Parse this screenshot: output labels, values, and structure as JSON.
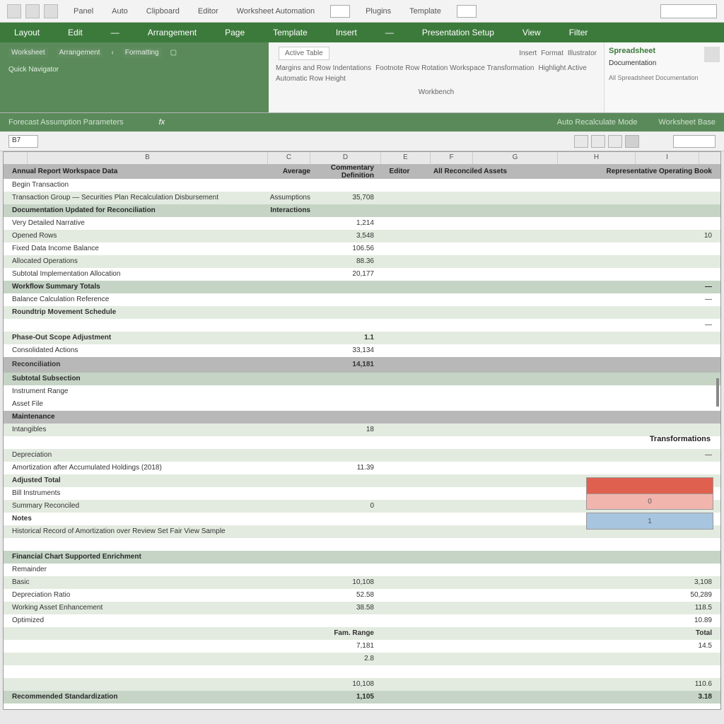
{
  "topStrip": {
    "menus": [
      "Panel",
      "Auto",
      "Clipboard",
      "Editor",
      "Worksheet Automation",
      "Plugins",
      "Template"
    ]
  },
  "ribbonTabs": [
    "Layout",
    "Edit",
    "—",
    "Arrangement",
    "Page",
    "Template",
    "Insert",
    "—",
    "Presentation Setup",
    "View",
    "Filter"
  ],
  "ribbonLeft": {
    "row1": [
      "Worksheet",
      "Arrangement",
      "Formatting"
    ],
    "row2": "Quick Navigator"
  },
  "ribbonCenter": {
    "input1": "Active Table",
    "labels1": [
      "Insert",
      "Format",
      "Illustrator"
    ],
    "line2a": "Margins and Row Indentations",
    "line2b": "Footnote Row Rotation Workspace Transformation",
    "line2c": "Highlight Active",
    "line3": "Automatic Row Height",
    "bottom": "Workbench"
  },
  "ribbonRight": {
    "title": "Spreadsheet",
    "item": "Documentation",
    "sub": "All Spreadsheet Documentation"
  },
  "greenBar": {
    "left": "Forecast Assumption Parameters",
    "fx": "fx",
    "mid1": "Auto Recalculate Mode",
    "mid2": "Worksheet Base"
  },
  "viewBar": {
    "cell": "B7"
  },
  "colHeaders": [
    "",
    "B",
    "C",
    "D",
    "E",
    "F",
    "G",
    "H",
    "I"
  ],
  "headerRow": {
    "label": "Annual Report Workspace Data",
    "c1": "Average",
    "c2": "Commentary Definition",
    "c3": "Editor",
    "c4": "All Reconciled Assets",
    "c5": "Representative Operating Book"
  },
  "rows": [
    {
      "cls": "",
      "label": "Begin Transaction",
      "v1": "",
      "v2": ""
    },
    {
      "cls": "alt",
      "label": "Transaction Group — Securities Plan Recalculation Disbursement",
      "v1": "Assumptions",
      "v2": "35,708"
    },
    {
      "cls": "subhead",
      "label": "Documentation Updated for Reconciliation",
      "v1": "Interactions",
      "v2": ""
    },
    {
      "cls": "",
      "label": "Very Detailed Narrative",
      "v1": "",
      "v2": "1,214",
      "far": ""
    },
    {
      "cls": "alt",
      "label": "Opened Rows",
      "v1": "",
      "v2": "3,548",
      "far": "10"
    },
    {
      "cls": "",
      "label": "Fixed Data Income Balance",
      "v1": "",
      "v2": "106.56",
      "far": ""
    },
    {
      "cls": "alt",
      "label": "Allocated Operations",
      "v1": "",
      "v2": "88.36",
      "far": ""
    },
    {
      "cls": "",
      "label": "Subtotal Implementation Allocation",
      "v1": "",
      "v2": "20,177",
      "far": ""
    },
    {
      "cls": "subhead",
      "label": "Workflow Summary Totals",
      "v1": "",
      "v2": "",
      "far": "—"
    },
    {
      "cls": "",
      "label": "Balance Calculation Reference",
      "v1": "",
      "v2": "",
      "far": "—"
    },
    {
      "cls": "alt bold",
      "label": "Roundtrip Movement Schedule",
      "v1": "",
      "v2": "",
      "far": ""
    },
    {
      "cls": "",
      "label": "",
      "v1": "",
      "v2": "",
      "far": "—"
    },
    {
      "cls": "alt bold",
      "label": "Phase-Out Scope Adjustment",
      "v1": "",
      "v2": "1.1",
      "far": ""
    },
    {
      "cls": "",
      "label": "Consolidated Actions",
      "v1": "",
      "v2": "33,134",
      "far": ""
    },
    {
      "cls": "greysec",
      "label": "Reconciliation",
      "v1": "",
      "v2": "14,181",
      "far": ""
    },
    {
      "cls": "subhead",
      "label": "Subtotal Subsection",
      "v1": "",
      "v2": "",
      "far": ""
    },
    {
      "cls": "",
      "label": "Instrument Range",
      "v1": "",
      "v2": "",
      "far": ""
    },
    {
      "cls": "",
      "label": "Asset File",
      "v1": "",
      "v2": "",
      "far": ""
    },
    {
      "cls": "section",
      "label": "Maintenance",
      "v1": "",
      "v2": "",
      "far": ""
    },
    {
      "cls": "alt",
      "label": "Intangibles",
      "v1": "",
      "v2": "18",
      "far": ""
    },
    {
      "cls": "",
      "label": "",
      "v1": "",
      "v2": "",
      "far": ""
    },
    {
      "cls": "alt",
      "label": "Depreciation",
      "v1": "",
      "v2": "",
      "far": "—"
    },
    {
      "cls": "",
      "label": "Amortization after Accumulated Holdings (2018)",
      "v1": "",
      "v2": "11.39",
      "far": ""
    },
    {
      "cls": "alt bold",
      "label": "Adjusted Total",
      "v1": "",
      "v2": "",
      "far": ""
    },
    {
      "cls": "",
      "label": "Bill Instruments",
      "v1": "",
      "v2": "",
      "far": ""
    },
    {
      "cls": "alt",
      "label": "Summary Reconciled",
      "v1": "",
      "v2": "0",
      "far": ""
    },
    {
      "cls": "bold",
      "label": "Notes",
      "v1": "",
      "v2": "",
      "far": ""
    },
    {
      "cls": "alt",
      "label": "Historical Record of Amortization over Review Set Fair View Sample",
      "v1": "",
      "v2": "",
      "far": ""
    },
    {
      "cls": "",
      "label": "",
      "v1": "",
      "v2": "",
      "far": ""
    },
    {
      "cls": "subhead",
      "label": "Financial Chart Supported Enrichment",
      "v1": "",
      "v2": "",
      "far": ""
    },
    {
      "cls": "",
      "label": "Remainder",
      "v1": "",
      "v2": "",
      "far": ""
    },
    {
      "cls": "alt",
      "label": "Basic",
      "v1": "",
      "v2": "10,108",
      "far": "3,108"
    },
    {
      "cls": "",
      "label": "Depreciation Ratio",
      "v1": "",
      "v2": "52.58",
      "far": "50,289"
    },
    {
      "cls": "alt",
      "label": "Working Asset Enhancement",
      "v1": "",
      "v2": "38.58",
      "far": "118.5"
    },
    {
      "cls": "",
      "label": "Optimized",
      "v1": "",
      "v2": "",
      "far": "10.89"
    },
    {
      "cls": "alt bold",
      "label": "",
      "v1": "",
      "v2": "Fam. Range",
      "far": "Total"
    },
    {
      "cls": "",
      "label": "",
      "v1": "",
      "v2": "7,181",
      "far": "14.5"
    },
    {
      "cls": "alt",
      "label": "",
      "v1": "",
      "v2": "2.8",
      "far": ""
    },
    {
      "cls": "",
      "label": "",
      "v1": "",
      "v2": "",
      "far": ""
    },
    {
      "cls": "alt",
      "label": "",
      "v1": "",
      "v2": "10,108",
      "far": "110.6"
    },
    {
      "cls": "subhead",
      "label": "Recommended Standardization",
      "v1": "",
      "v2": "1,105",
      "far": "3.18"
    }
  ],
  "floatLabel": "Transformations",
  "colorCells": {
    "r2": "0",
    "b": "1"
  }
}
